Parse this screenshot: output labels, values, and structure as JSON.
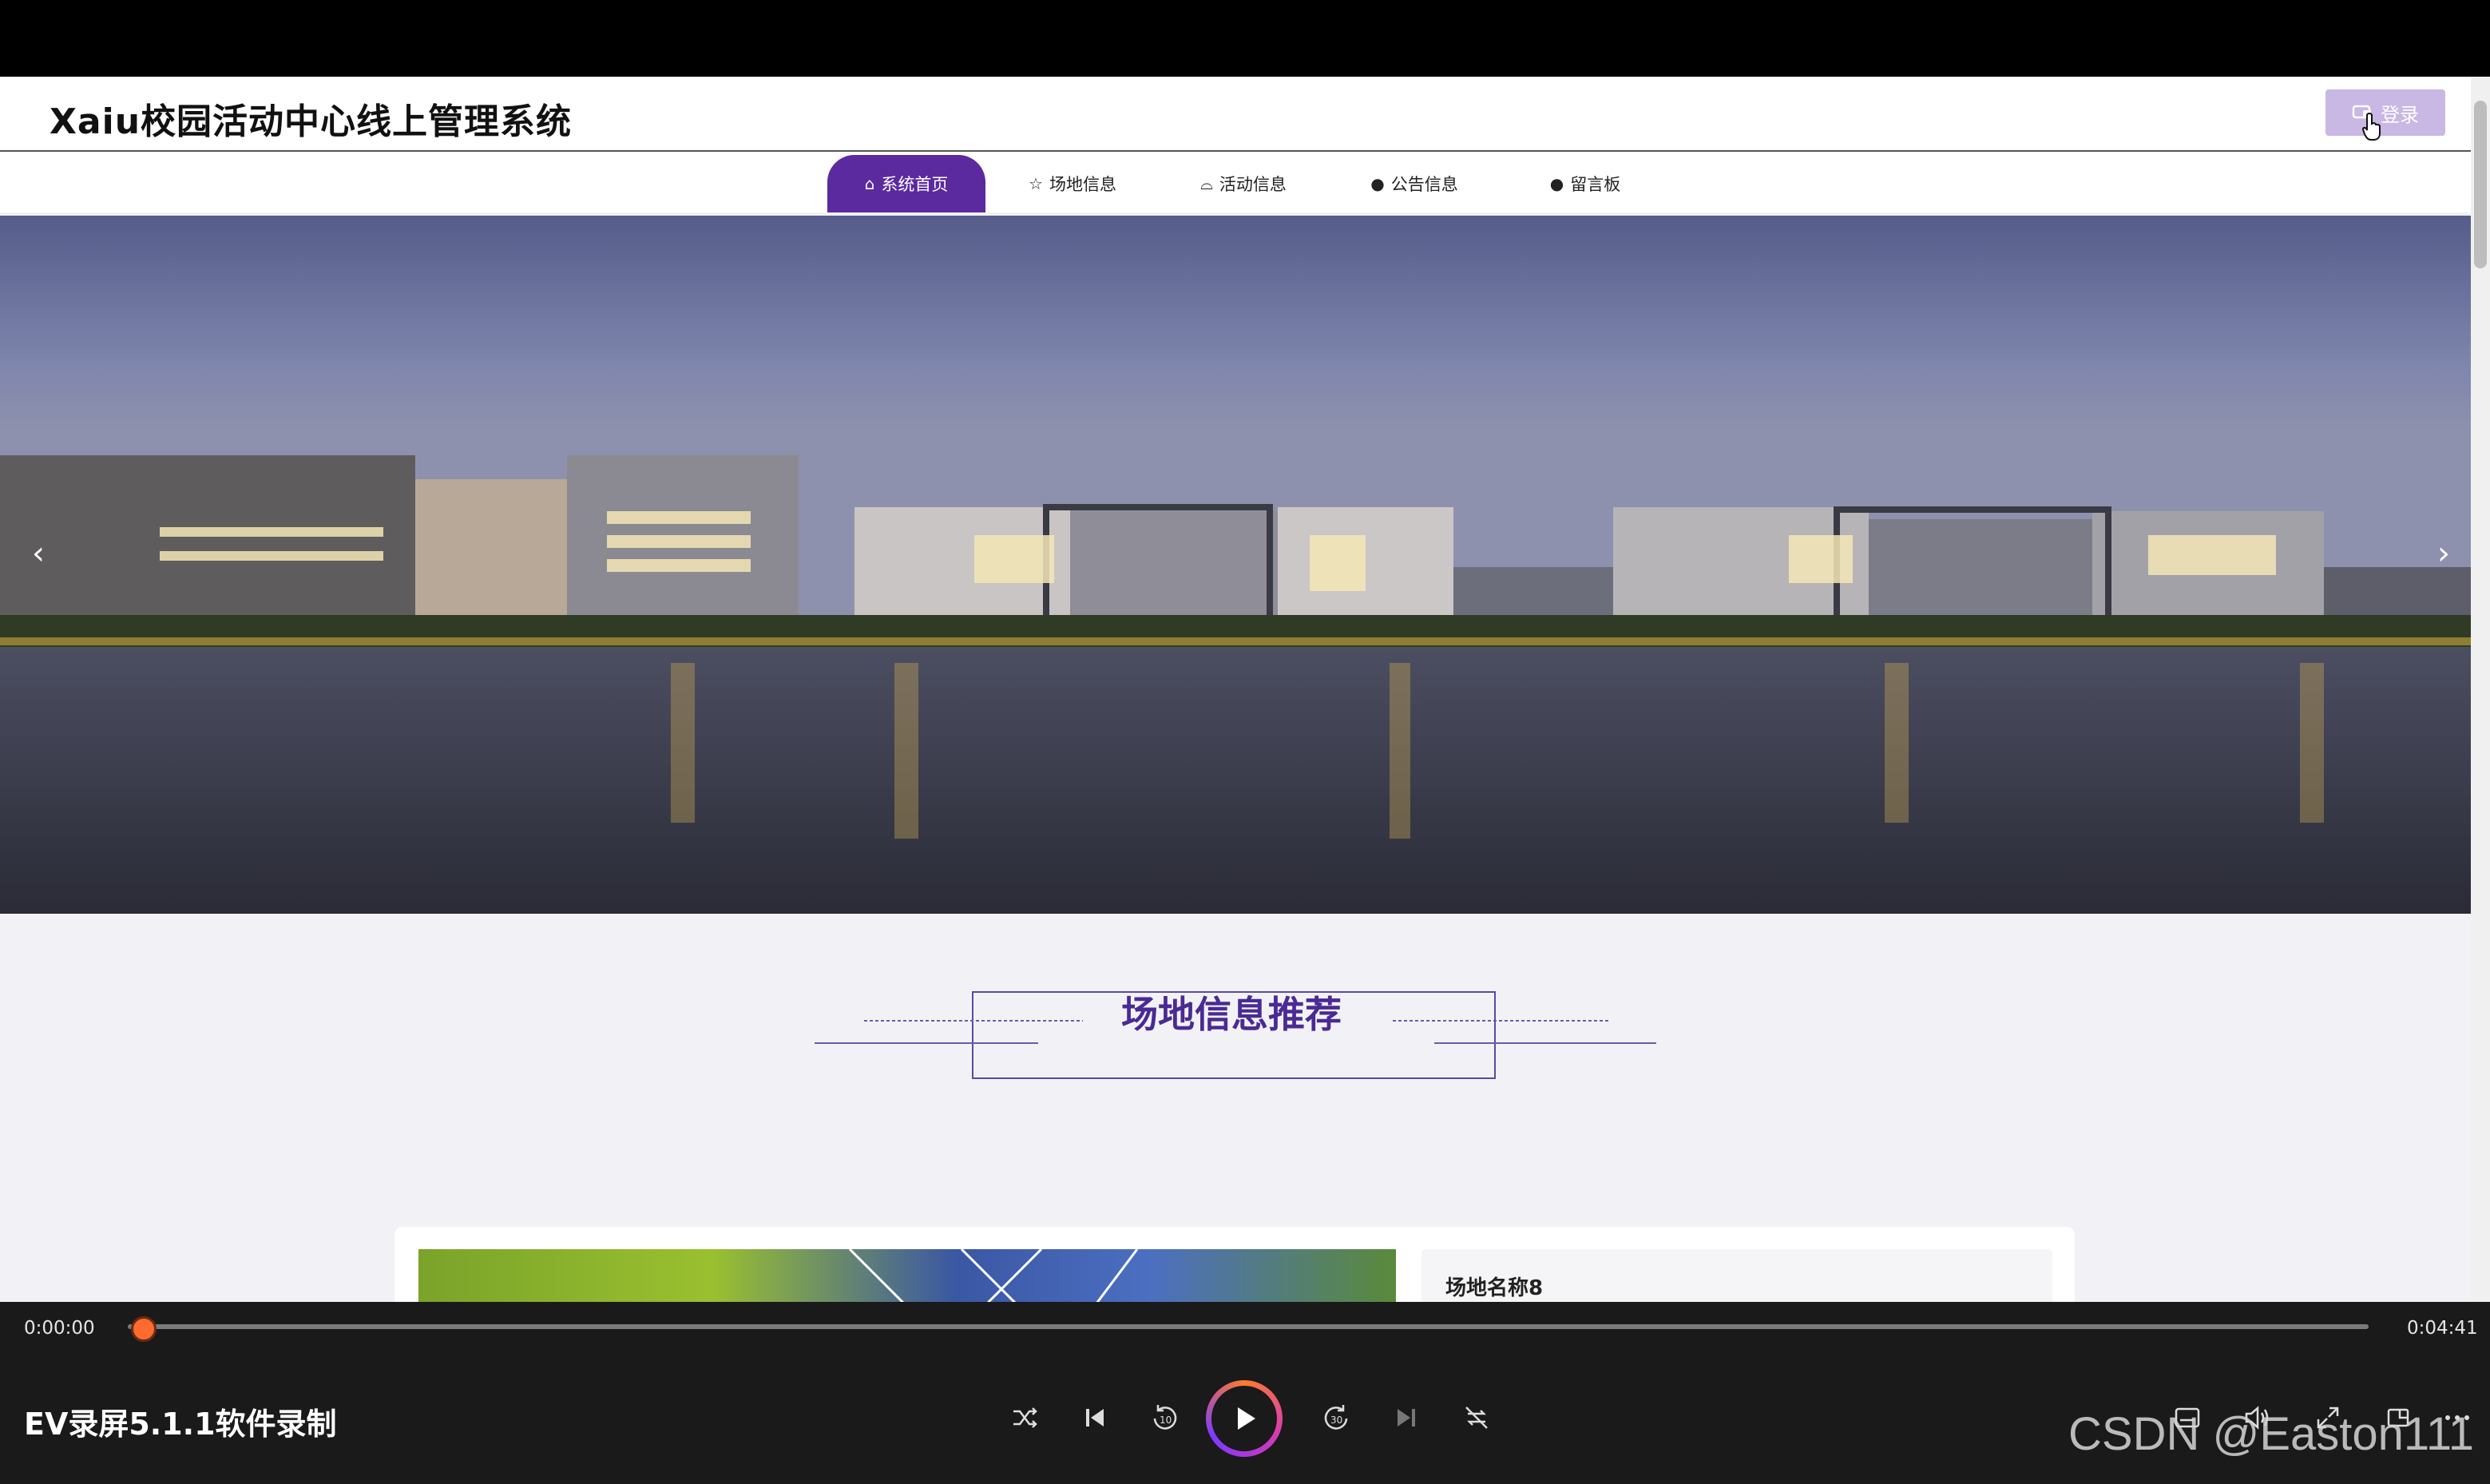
{
  "site": {
    "title": "Xaiu校园活动中心线上管理系统",
    "login_label": "登录"
  },
  "nav": {
    "items": [
      {
        "label": "系统首页",
        "icon": "home-icon",
        "active": true
      },
      {
        "label": "场地信息",
        "icon": "star-icon",
        "active": false
      },
      {
        "label": "活动信息",
        "icon": "bag-icon",
        "active": false
      },
      {
        "label": "公告信息",
        "icon": "info-icon",
        "active": false
      },
      {
        "label": "留言板",
        "icon": "question-icon",
        "active": false
      }
    ]
  },
  "banner": {
    "prev_icon": "chevron-left-icon",
    "next_icon": "chevron-right-icon"
  },
  "section": {
    "title": "场地信息推荐"
  },
  "card": {
    "name": "场地名称8"
  },
  "player": {
    "current_time": "0:00:00",
    "total_time": "0:04:41",
    "progress": 0.0,
    "title": "EV录屏5.1.1软件录制"
  },
  "watermark": "CSDN @Easton111",
  "colors": {
    "accent": "#5b2a9e",
    "login_button": "#c9b7e4",
    "section_title": "#4a2a94",
    "progress_knob": "#ff6a2f"
  }
}
